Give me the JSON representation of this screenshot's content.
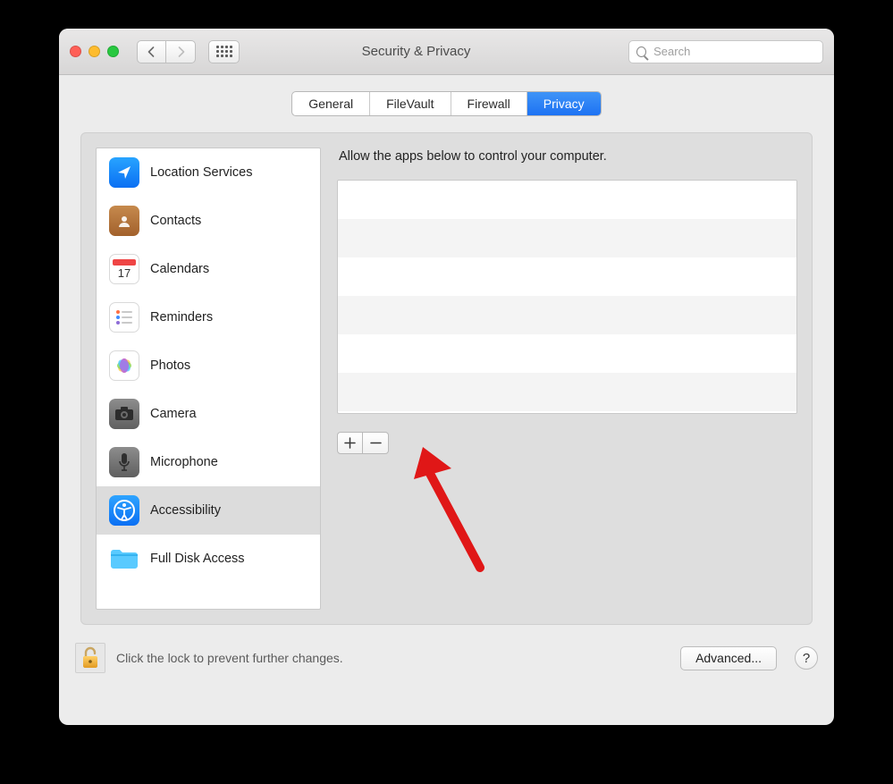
{
  "window": {
    "title": "Security & Privacy",
    "search_placeholder": "Search"
  },
  "tabs": [
    {
      "id": "general",
      "label": "General",
      "active": false
    },
    {
      "id": "filevault",
      "label": "FileVault",
      "active": false
    },
    {
      "id": "firewall",
      "label": "Firewall",
      "active": false
    },
    {
      "id": "privacy",
      "label": "Privacy",
      "active": true
    }
  ],
  "sidebar": {
    "items": [
      {
        "id": "location-services",
        "label": "Location Services",
        "icon": "location-arrow",
        "selected": false
      },
      {
        "id": "contacts",
        "label": "Contacts",
        "icon": "address-book",
        "selected": false
      },
      {
        "id": "calendars",
        "label": "Calendars",
        "icon": "calendar",
        "selected": false
      },
      {
        "id": "reminders",
        "label": "Reminders",
        "icon": "reminders",
        "selected": false
      },
      {
        "id": "photos",
        "label": "Photos",
        "icon": "photos-flower",
        "selected": false
      },
      {
        "id": "camera",
        "label": "Camera",
        "icon": "camera",
        "selected": false
      },
      {
        "id": "microphone",
        "label": "Microphone",
        "icon": "microphone",
        "selected": false
      },
      {
        "id": "accessibility",
        "label": "Accessibility",
        "icon": "accessibility",
        "selected": true
      },
      {
        "id": "full-disk-access",
        "label": "Full Disk Access",
        "icon": "folder",
        "selected": false
      }
    ]
  },
  "right_pane": {
    "description": "Allow the apps below to control your computer.",
    "apps": []
  },
  "footer": {
    "lock_text": "Click the lock to prevent further changes.",
    "advanced_label": "Advanced...",
    "help_label": "?"
  },
  "colors": {
    "accent_blue": "#2d7bf6",
    "icon_blue": "#1d8af6",
    "selection_gray": "#dcdcdc"
  },
  "annotation": {
    "type": "arrow",
    "color": "#e21b1b",
    "points_to": "add-button"
  }
}
